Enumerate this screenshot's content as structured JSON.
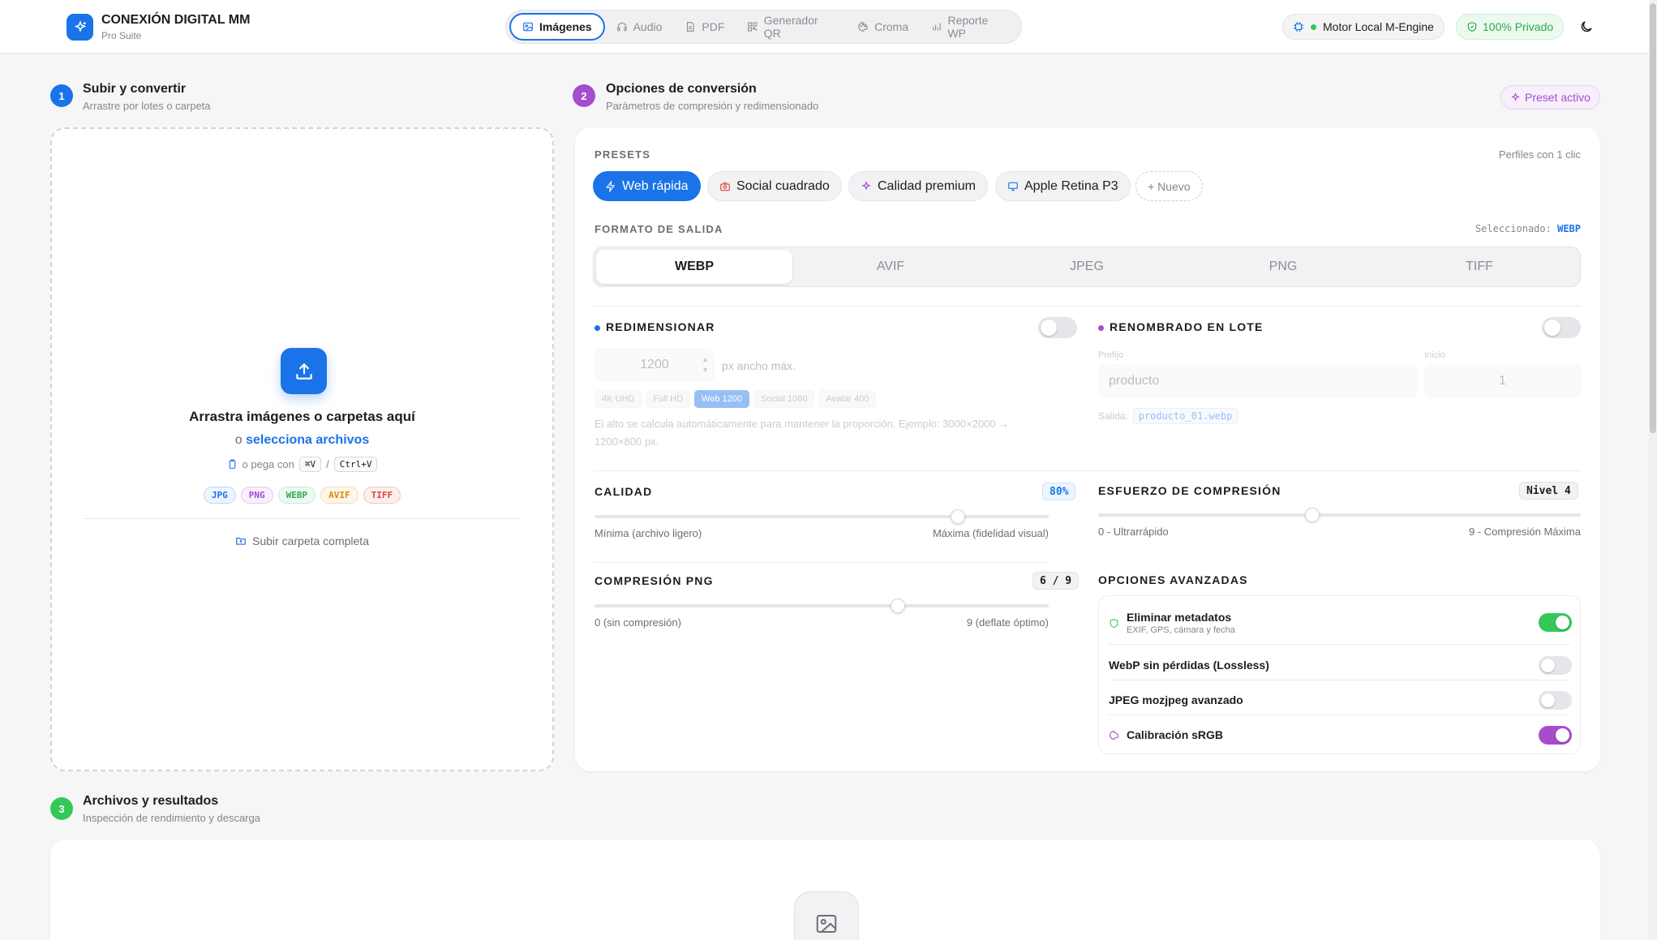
{
  "brand": {
    "name": "CONEXIÓN DIGITAL MM",
    "subtitle": "Pro Suite"
  },
  "nav": [
    {
      "label": "Imágenes",
      "icon": "image-icon",
      "active": true
    },
    {
      "label": "Audio",
      "icon": "headphones-icon"
    },
    {
      "label": "PDF",
      "icon": "document-icon"
    },
    {
      "label": "Generador QR",
      "icon": "qr-icon"
    },
    {
      "label": "Croma",
      "icon": "palette-icon"
    },
    {
      "label": "Reporte WP",
      "icon": "bar-chart-icon"
    }
  ],
  "header_right": {
    "engine": "Motor Local M-Engine",
    "privacy": "100% Privado"
  },
  "section1": {
    "number": "1",
    "title": "Subir y convertir",
    "subtitle": "Arrastre por lotes o carpeta"
  },
  "section2": {
    "number": "2",
    "title": "Opciones de conversión",
    "subtitle": "Parámetros de compresión y redimensionado",
    "badge": "Preset activo"
  },
  "section3": {
    "number": "3",
    "title": "Archivos y resultados",
    "subtitle": "Inspección de rendimiento y descarga"
  },
  "upload": {
    "title": "Arrastra imágenes o carpetas aquí",
    "or": "o",
    "select_link": "selecciona archivos",
    "paste_text": "o pega con",
    "kbd_mac": "⌘V",
    "kbd_sep": "/",
    "kbd_win": "Ctrl+V",
    "formats": [
      "JPG",
      "PNG",
      "WEBP",
      "AVIF",
      "TIFF"
    ],
    "folder_button": "Subir carpeta completa"
  },
  "presets": {
    "label": "PRESETS",
    "hint": "Perfiles con 1 clic",
    "items": [
      "Web rápida",
      "Social cuadrado",
      "Calidad premium",
      "Apple Retina P3"
    ],
    "new_label": "+ Nuevo"
  },
  "output_format": {
    "label": "FORMATO DE SALIDA",
    "selected_prefix": "Seleccionado:",
    "selected": "WEBP",
    "options": [
      "WEBP",
      "AVIF",
      "JPEG",
      "PNG",
      "TIFF"
    ]
  },
  "resize": {
    "label": "REDIMENSIONAR",
    "enabled": false,
    "width_value": "1200",
    "unit": "px ancho máx.",
    "quick_sizes": [
      "4K UHD",
      "Full HD",
      "Web 1200",
      "Social 1080",
      "Avatar 400"
    ],
    "active_size": "Web 1200",
    "note": "El alto se calcula automáticamente para mantener la proporción. Ejemplo: 3000×2000 → 1200×800 px."
  },
  "rename": {
    "label": "RENOMBRADO EN LOTE",
    "enabled": false,
    "prefix_label": "Prefijo",
    "prefix_value": "producto",
    "start_label": "Inicio",
    "start_value": "1",
    "output_label": "Salida:",
    "output_value": "producto_01.webp"
  },
  "quality": {
    "label": "CALIDAD",
    "value_text": "80%",
    "fraction": 0.8,
    "min_label": "Mínima (archivo ligero)",
    "max_label": "Máxima (fidelidad visual)"
  },
  "effort": {
    "label": "ESFUERZO DE COMPRESIÓN",
    "value_text": "Nivel 4",
    "fraction": 0.444,
    "min_label": "0 - Ultrarrápido",
    "max_label": "9 - Compresión Máxima"
  },
  "png_compression": {
    "label": "COMPRESIÓN PNG",
    "value_text": "6 / 9",
    "fraction": 0.667,
    "min_label": "0 (sin compresión)",
    "max_label": "9 (deflate óptimo)"
  },
  "advanced": {
    "label": "OPCIONES AVANZADAS",
    "items": [
      {
        "title": "Eliminar metadatos",
        "subtitle": "EXIF, GPS, cámara y fecha",
        "on": true
      },
      {
        "title": "WebP sin pérdidas (Lossless)",
        "on": false
      },
      {
        "title": "JPEG mozjpeg avanzado",
        "on": false
      },
      {
        "title": "Calibración sRGB",
        "on": true
      }
    ]
  },
  "colors": {
    "accent": "#1a73e8",
    "purple": "#a64ccf",
    "green": "#34c759"
  }
}
